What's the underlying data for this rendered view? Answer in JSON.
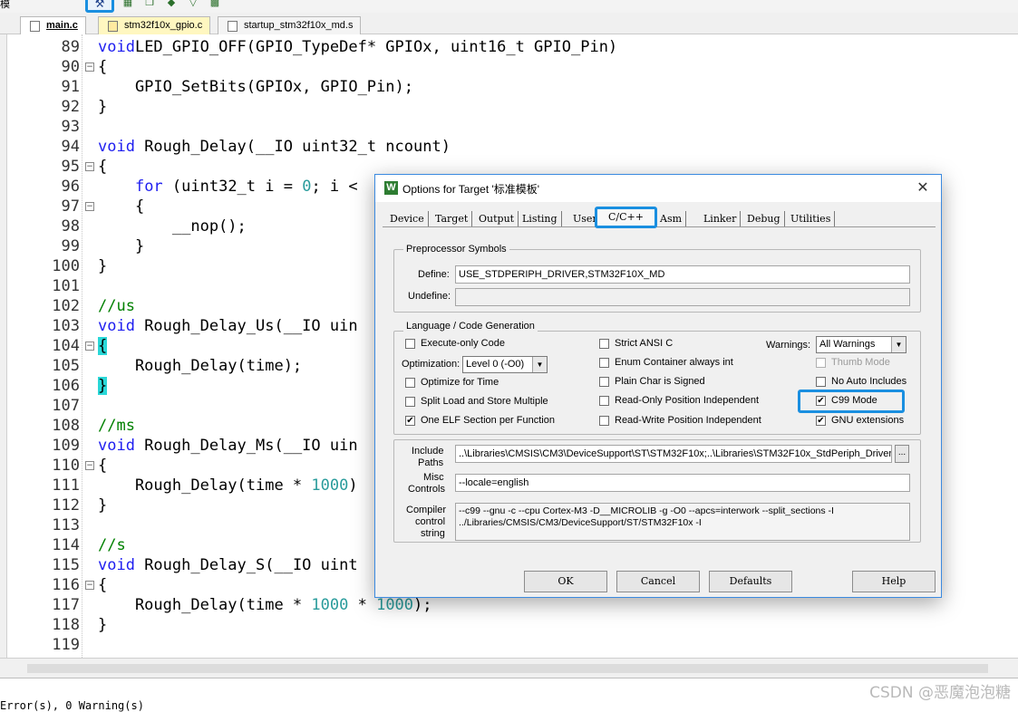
{
  "toolbar": {
    "left_text": "模",
    "icons": [
      "target-options-icon",
      "component-icon",
      "copy-icon",
      "download-icon",
      "filter-icon",
      "map-icon"
    ]
  },
  "tabs": [
    {
      "label": "main.c"
    },
    {
      "label": "stm32f10x_gpio.c"
    },
    {
      "label": "startup_stm32f10x_md.s"
    }
  ],
  "editor": {
    "lines": [
      {
        "n": "89",
        "fold": "",
        "segs": [
          [
            "kw",
            "void"
          ],
          [
            "",
            "LED_GPIO_OFF(GPIO_TypeDef* GPIOx, uint16_t GPIO_Pin)"
          ]
        ]
      },
      {
        "n": "90",
        "fold": "−",
        "segs": [
          [
            "",
            "{"
          ]
        ]
      },
      {
        "n": "91",
        "fold": "",
        "segs": [
          [
            "",
            "    GPIO_SetBits(GPIOx, GPIO_Pin);"
          ]
        ]
      },
      {
        "n": "92",
        "fold": "",
        "segs": [
          [
            "",
            "}"
          ]
        ]
      },
      {
        "n": "93",
        "fold": "",
        "segs": []
      },
      {
        "n": "94",
        "fold": "",
        "segs": [
          [
            "kw",
            "void"
          ],
          [
            "",
            " Rough_Delay(__IO uint32_t ncount)"
          ]
        ]
      },
      {
        "n": "95",
        "fold": "−",
        "segs": [
          [
            "",
            "{"
          ]
        ]
      },
      {
        "n": "96",
        "fold": "",
        "segs": [
          [
            "",
            "    "
          ],
          [
            "kw",
            "for"
          ],
          [
            "",
            " (uint32_t i = "
          ],
          [
            "num",
            "0"
          ],
          [
            "",
            "; i <"
          ]
        ]
      },
      {
        "n": "97",
        "fold": "−",
        "segs": [
          [
            "",
            "    {"
          ]
        ]
      },
      {
        "n": "98",
        "fold": "",
        "segs": [
          [
            "",
            "        __nop();"
          ]
        ]
      },
      {
        "n": "99",
        "fold": "",
        "segs": [
          [
            "",
            "    }"
          ]
        ]
      },
      {
        "n": "100",
        "fold": "",
        "segs": [
          [
            "",
            "}"
          ]
        ]
      },
      {
        "n": "101",
        "fold": "",
        "segs": []
      },
      {
        "n": "102",
        "fold": "",
        "segs": [
          [
            "cm",
            "//us"
          ]
        ]
      },
      {
        "n": "103",
        "fold": "",
        "segs": [
          [
            "kw",
            "void"
          ],
          [
            "",
            " Rough_Delay_Us(__IO uin"
          ]
        ]
      },
      {
        "n": "104",
        "fold": "−",
        "segs": [
          [
            "brc",
            "{"
          ]
        ]
      },
      {
        "n": "105",
        "fold": "",
        "segs": [
          [
            "",
            "    Rough_Delay(time);"
          ]
        ]
      },
      {
        "n": "106",
        "fold": "",
        "segs": [
          [
            "brc",
            "}"
          ]
        ]
      },
      {
        "n": "107",
        "fold": "",
        "segs": []
      },
      {
        "n": "108",
        "fold": "",
        "segs": [
          [
            "cm",
            "//ms"
          ]
        ]
      },
      {
        "n": "109",
        "fold": "",
        "segs": [
          [
            "kw",
            "void"
          ],
          [
            "",
            " Rough_Delay_Ms(__IO uin"
          ]
        ]
      },
      {
        "n": "110",
        "fold": "−",
        "segs": [
          [
            "",
            "{"
          ]
        ]
      },
      {
        "n": "111",
        "fold": "",
        "segs": [
          [
            "",
            "    Rough_Delay(time * "
          ],
          [
            "num",
            "1000"
          ],
          [
            "",
            ")"
          ]
        ]
      },
      {
        "n": "112",
        "fold": "",
        "segs": [
          [
            "",
            "}"
          ]
        ]
      },
      {
        "n": "113",
        "fold": "",
        "segs": []
      },
      {
        "n": "114",
        "fold": "",
        "segs": [
          [
            "cm",
            "//s"
          ]
        ]
      },
      {
        "n": "115",
        "fold": "",
        "segs": [
          [
            "kw",
            "void"
          ],
          [
            "",
            " Rough_Delay_S(__IO uint"
          ]
        ]
      },
      {
        "n": "116",
        "fold": "−",
        "segs": [
          [
            "",
            "{"
          ]
        ]
      },
      {
        "n": "117",
        "fold": "",
        "segs": [
          [
            "",
            "    Rough_Delay(time * "
          ],
          [
            "num",
            "1000"
          ],
          [
            "",
            " * "
          ],
          [
            "num",
            "1000"
          ],
          [
            "",
            ");"
          ]
        ]
      },
      {
        "n": "118",
        "fold": "",
        "segs": [
          [
            "",
            "}"
          ]
        ]
      },
      {
        "n": "119",
        "fold": "",
        "segs": []
      }
    ]
  },
  "dialog": {
    "title": "Options for Target '标准模板'",
    "tabs": [
      "Device",
      "Target",
      "Output",
      "Listing",
      "User",
      "C/C++",
      "Asm",
      "Linker",
      "Debug",
      "Utilities"
    ],
    "preprocessor": {
      "group_label": "Preprocessor Symbols",
      "define_label": "Define:",
      "define_value": "USE_STDPERIPH_DRIVER,STM32F10X_MD",
      "undefine_label": "Undefine:",
      "undefine_value": ""
    },
    "language": {
      "group_label": "Language / Code Generation",
      "execute_only": "Execute-only Code",
      "optimization_label": "Optimization:",
      "optimization_value": "Level 0 (-O0)",
      "optimize_time": "Optimize for Time",
      "split_load": "Split Load and Store Multiple",
      "one_elf": "One ELF Section per Function",
      "strict_ansi": "Strict ANSI C",
      "enum_container": "Enum Container always int",
      "plain_char": "Plain Char is Signed",
      "ro_pos": "Read-Only Position Independent",
      "rw_pos": "Read-Write Position Independent",
      "warnings_label": "Warnings:",
      "warnings_value": "All Warnings",
      "thumb_mode": "Thumb Mode",
      "no_auto_includes": "No Auto Includes",
      "c99_mode": "C99 Mode",
      "gnu_extensions": "GNU extensions",
      "check_mark": "✔"
    },
    "include": {
      "paths_label_1": "Include",
      "paths_label_2": "Paths",
      "paths_value": "..\\Libraries\\CMSIS\\CM3\\DeviceSupport\\ST\\STM32F10x;..\\Libraries\\STM32F10x_StdPeriph_Driver\\",
      "browse_label": "...",
      "misc_label_1": "Misc",
      "misc_label_2": "Controls",
      "misc_value": "--locale=english",
      "compiler_label_1": "Compiler",
      "compiler_label_2": "control",
      "compiler_label_3": "string",
      "compiler_value": "--c99 --gnu -c --cpu Cortex-M3 -D__MICROLIB -g -O0 --apcs=interwork --split_sections -I\n../Libraries/CMSIS/CM3/DeviceSupport/ST/STM32F10x -I"
    },
    "buttons": {
      "ok": "OK",
      "cancel": "Cancel",
      "defaults": "Defaults",
      "help": "Help"
    },
    "close_glyph": "✕",
    "app_icon_glyph": "W"
  },
  "status": {
    "build_output": "Error(s), 0 Warning(s)",
    "watermark": "CSDN @恶魔泡泡糖"
  },
  "colors": {
    "highlight": "#1a8fe0",
    "keyword": "#1e1ef0",
    "comment": "#008000",
    "number": "#2a9c9c",
    "bracket_match": "#2ad8d8"
  }
}
